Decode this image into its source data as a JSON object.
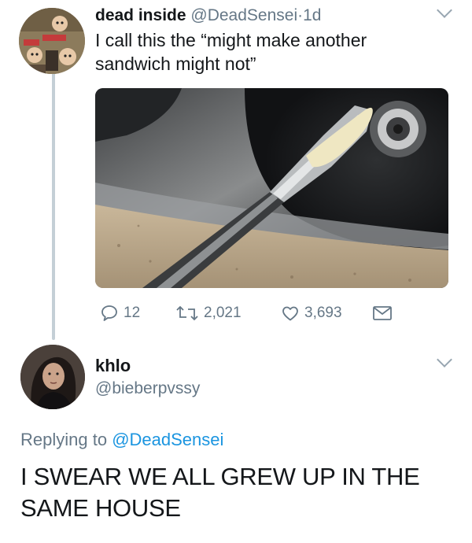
{
  "tweet": {
    "author": {
      "name": "dead inside",
      "handle": "@DeadSensei",
      "separator": "·",
      "time": "1d"
    },
    "text": "I call this the “might make another sandwich might not”",
    "media": {
      "description_icon": "photo-butter-knife-on-sink"
    },
    "actions": {
      "replies": "12",
      "retweets": "2,021",
      "likes": "3,693"
    }
  },
  "reply": {
    "author": {
      "name": "khlo",
      "handle": "@bieberpvssy"
    },
    "replying_prefix": "Replying to",
    "replying_to": "@DeadSensei",
    "text": "I SWEAR WE ALL GREW UP IN THE SAME HOUSE"
  },
  "colors": {
    "secondary_text": "#657786",
    "link": "#1b95e0",
    "thread_line": "#c4cfd6"
  }
}
